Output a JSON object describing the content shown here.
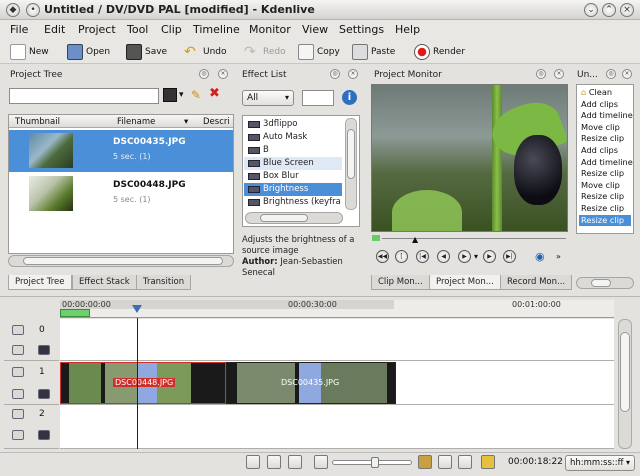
{
  "window": {
    "title": "Untitled / DV/DVD PAL [modified] - Kdenlive"
  },
  "menu": [
    "File",
    "Edit",
    "Project",
    "Tool",
    "Clip",
    "Timeline",
    "Monitor",
    "View",
    "Settings",
    "Help"
  ],
  "toolbar": {
    "new": "New",
    "open": "Open",
    "save": "Save",
    "undo": "Undo",
    "redo": "Redo",
    "copy": "Copy",
    "paste": "Paste",
    "render": "Render"
  },
  "project_tree": {
    "title": "Project Tree",
    "columns": [
      "Thumbnail",
      "Filename",
      "Descri"
    ],
    "clips": [
      {
        "filename": "DSC00435.JPG",
        "duration": "5 sec. (1)"
      },
      {
        "filename": "DSC00448.JPG",
        "duration": "5 sec. (1)"
      }
    ],
    "tabs": [
      "Project Tree",
      "Effect Stack",
      "Transition"
    ]
  },
  "effect_list": {
    "title": "Effect List",
    "filter_value": "All",
    "items": [
      "3dflippo",
      "Auto Mask",
      "B",
      "Blue Screen",
      "Box Blur",
      "Brightness",
      "Brightness (keyfra"
    ],
    "description": "Adjusts the brightness of a source image",
    "author_label": "Author:",
    "author": "Jean-Sebastien Senecal"
  },
  "project_monitor": {
    "title": "Project Monitor",
    "tabs": [
      "Clip Mon...",
      "Project Mon...",
      "Record Mon..."
    ]
  },
  "undo_history": {
    "title": "Un...",
    "items": [
      "Clean",
      "Add clips",
      "Add timeline",
      "Move clip",
      "Resize clip",
      "Add clips",
      "Add timeline",
      "Resize clip",
      "Move clip",
      "Resize clip",
      "Resize clip",
      "Resize clip"
    ]
  },
  "timeline": {
    "ruler_labels": [
      "00:00:00:00",
      "00:00:30:00",
      "00:01:00:00"
    ],
    "tracks": [
      "0",
      "1",
      "2"
    ],
    "clips": [
      {
        "label": "DSC00448.JPG"
      },
      {
        "label": "DSC00435.JPG"
      }
    ]
  },
  "statusbar": {
    "timecode": "00:00:18:22",
    "format": "hh:mm:ss::ff"
  },
  "colors": {
    "selection": "#4a8fd8",
    "clip_selected_red": "#d0302c",
    "transition_blue": "#8fa8e0"
  }
}
